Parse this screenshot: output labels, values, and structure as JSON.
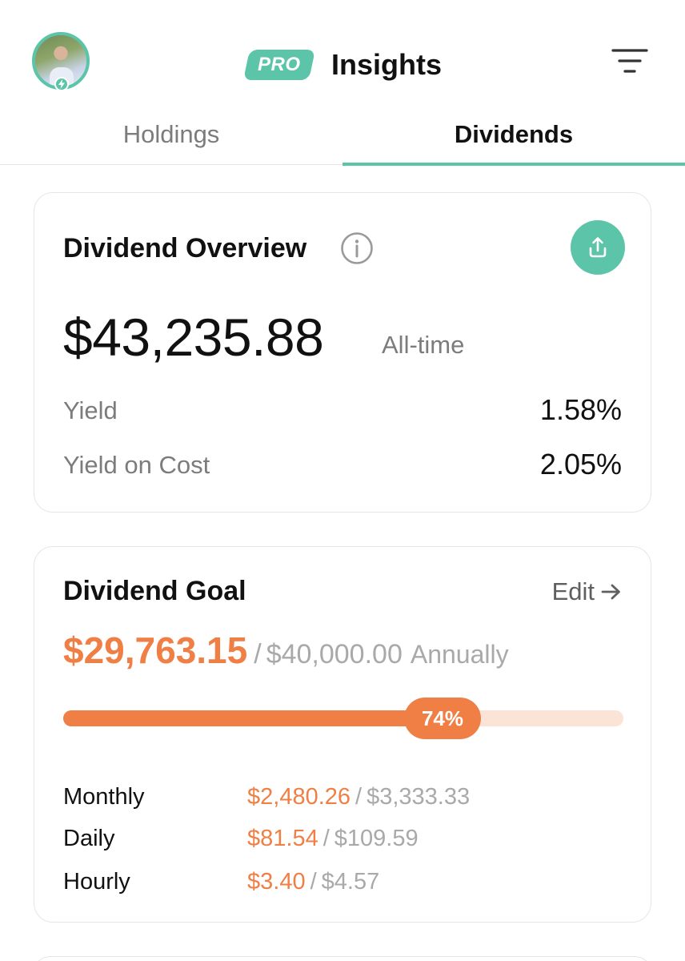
{
  "header": {
    "pro_badge": "PRO",
    "title": "Insights"
  },
  "tabs": [
    {
      "label": "Holdings",
      "active": false
    },
    {
      "label": "Dividends",
      "active": true
    }
  ],
  "overview": {
    "title": "Dividend Overview",
    "amount": "$43,235.88",
    "period": "All-time",
    "stats": [
      {
        "label": "Yield",
        "value": "1.58%"
      },
      {
        "label": "Yield on Cost",
        "value": "2.05%"
      }
    ]
  },
  "goal": {
    "title": "Dividend Goal",
    "edit_label": "Edit",
    "current": "$29,763.15",
    "separator": "/",
    "target": "$40,000.00",
    "period": "Annually",
    "progress_label": "74%",
    "progress_fraction": 0.74,
    "breakdown": [
      {
        "label": "Monthly",
        "current": "$2,480.26",
        "target": "$3,333.33"
      },
      {
        "label": "Daily",
        "current": "$81.54",
        "target": "$109.59"
      },
      {
        "label": "Hourly",
        "current": "$3.40",
        "target": "$4.57"
      }
    ]
  },
  "colors": {
    "accent": "#5cc4a8",
    "goal": "#ef7f45",
    "goal_track": "#fbe3d6",
    "muted": "#7c7c7c"
  },
  "icons": {
    "filter": "filter-lines-icon",
    "info": "info-icon",
    "share": "share-upload-icon",
    "edit_arrow": "arrow-right-icon"
  }
}
